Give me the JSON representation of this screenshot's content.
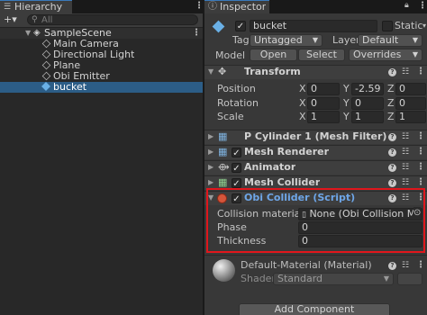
{
  "hierarchy": {
    "tab_label": "Hierarchy",
    "add_label": "+▾",
    "search_placeholder": "All",
    "scene_name": "SampleScene",
    "items": [
      {
        "label": "Main Camera"
      },
      {
        "label": "Directional Light"
      },
      {
        "label": "Plane"
      },
      {
        "label": "Obi Emitter"
      },
      {
        "label": "bucket",
        "selected": true
      }
    ]
  },
  "inspector": {
    "tab_label": "Inspector",
    "object_name": "bucket",
    "static_label": "Static",
    "tag_label": "Tag",
    "tag_value": "Untagged",
    "layer_label": "Layer",
    "layer_value": "Default",
    "model_label": "Model",
    "open_label": "Open",
    "select_label": "Select",
    "overrides_label": "Overrides",
    "transform": {
      "title": "Transform",
      "position_label": "Position",
      "rotation_label": "Rotation",
      "scale_label": "Scale",
      "axis_x": "X",
      "axis_y": "Y",
      "axis_z": "Z",
      "position": {
        "x": "0",
        "y": "-2.59",
        "z": "0"
      },
      "rotation": {
        "x": "0",
        "y": "0",
        "z": "0"
      },
      "scale": {
        "x": "1",
        "y": "1",
        "z": "1"
      }
    },
    "components": [
      {
        "title": "P Cylinder 1 (Mesh Filter)"
      },
      {
        "title": "Mesh Renderer"
      },
      {
        "title": "Animator"
      },
      {
        "title": "Mesh Collider"
      }
    ],
    "obi_collider": {
      "title": "Obi Collider (Script)",
      "collision_material_label": "Collision material",
      "collision_material_value": "None (Obi Collision Materi",
      "phase_label": "Phase",
      "phase_value": "0",
      "thickness_label": "Thickness",
      "thickness_value": "0"
    },
    "material": {
      "name": "Default-Material (Material)",
      "shader_label": "Shader",
      "shader_value": "Standard"
    },
    "add_component_label": "Add Component"
  },
  "colors": {
    "highlight_box": "#e0161c",
    "selection": "#2c5d87",
    "script_title": "#6ea6e8",
    "accent_tab": "#3a79bb"
  }
}
